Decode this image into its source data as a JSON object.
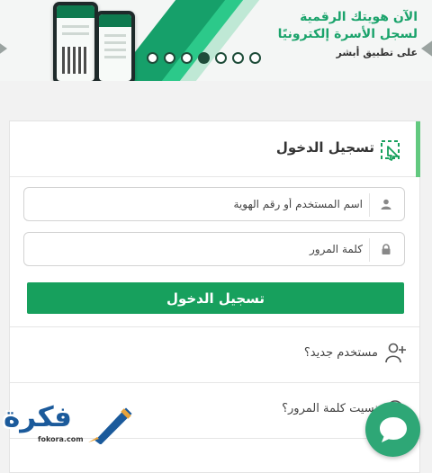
{
  "banner": {
    "line1": "الآن هويتك الرقمية",
    "line2": "لسجل الأسرة إلكترونيًا",
    "line3": "على تطبيق أبشر",
    "dots_total": 7,
    "active_dot": 4
  },
  "login": {
    "title": "تسجيل الدخول",
    "username_placeholder": "اسم المستخدم أو رقم الهوية",
    "password_placeholder": "كلمة المرور",
    "submit_label": "تسجيل الدخول"
  },
  "links": {
    "new_user": "مستخدم جديد؟",
    "forgot_password": "نسيت كلمة المرور؟"
  },
  "watermark": {
    "brand": "فكرة",
    "domain": "fokora.com"
  },
  "colors": {
    "accent": "#17a05d",
    "header_bar": "#62c97f",
    "watermark": "#1b5a9b",
    "chat": "#2ea776"
  }
}
